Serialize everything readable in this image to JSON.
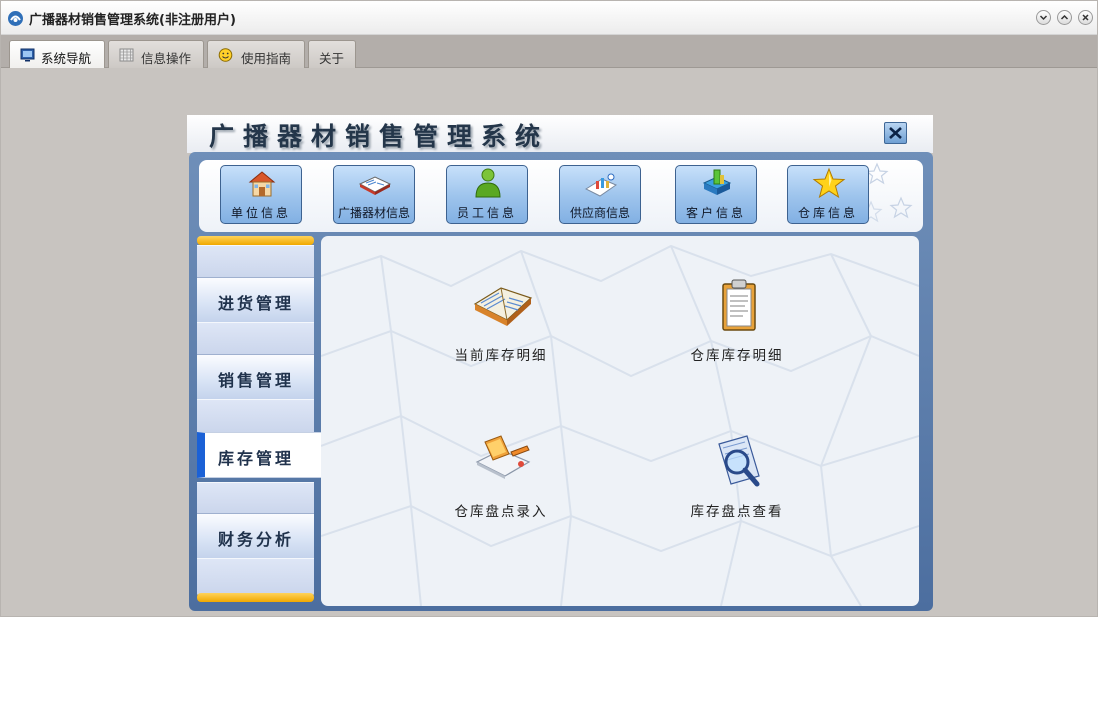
{
  "window": {
    "title": "广播器材销售管理系统(非注册用户)"
  },
  "tabs": [
    {
      "label": "系统导航",
      "icon": "monitor-icon",
      "active": true
    },
    {
      "label": "信息操作",
      "icon": "grid-icon",
      "active": false
    },
    {
      "label": "使用指南",
      "icon": "smiley-icon",
      "active": false
    },
    {
      "label": "关于",
      "icon": "",
      "active": false
    }
  ],
  "panel": {
    "title": "广播器材销售管理系统"
  },
  "toolbar": {
    "items": [
      {
        "label": "单位信息",
        "icon": "house-icon"
      },
      {
        "label": "广播器材信息",
        "icon": "book-icon"
      },
      {
        "label": "员工信息",
        "icon": "person-icon"
      },
      {
        "label": "供应商信息",
        "icon": "chart-icon"
      },
      {
        "label": "客户信息",
        "icon": "cube-icon"
      },
      {
        "label": "仓库信息",
        "icon": "star-icon"
      }
    ]
  },
  "sidebar": {
    "items": [
      {
        "label": "进货管理",
        "active": false
      },
      {
        "label": "销售管理",
        "active": false
      },
      {
        "label": "库存管理",
        "active": true
      },
      {
        "label": "财务分析",
        "active": false
      }
    ]
  },
  "main": {
    "items": [
      {
        "label": "当前库存明细",
        "icon": "open-book-icon"
      },
      {
        "label": "仓库库存明细",
        "icon": "clipboard-icon"
      },
      {
        "label": "仓库盘点录入",
        "icon": "laptop-pencil-icon"
      },
      {
        "label": "库存盘点查看",
        "icon": "magnifier-icon"
      }
    ]
  },
  "colors": {
    "accent_blue": "#1b61d6",
    "sidebar_cap": "#f0a800",
    "frame_blue": "#4c6e9f"
  }
}
